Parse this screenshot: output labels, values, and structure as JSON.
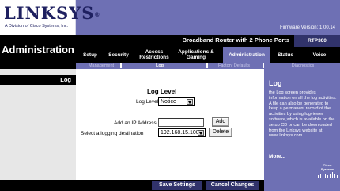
{
  "brand": {
    "logo_text": "LINKSYS",
    "tagline": "A Division of Cisco Systems, Inc.",
    "firmware": "Firmware Version: 1.00.14"
  },
  "header": {
    "section_title": "Administration",
    "product_name": "Broadband Router with 2 Phone Ports",
    "model": "RTP300"
  },
  "tabs": [
    {
      "label": "Setup"
    },
    {
      "label": "Security"
    },
    {
      "label": "Access Restrictions"
    },
    {
      "label": "Applications & Gaming"
    },
    {
      "label": "Administration",
      "active": true
    },
    {
      "label": "Status"
    },
    {
      "label": "Voice"
    }
  ],
  "subtabs": [
    {
      "label": "Management"
    },
    {
      "label": "Log",
      "active": true
    },
    {
      "label": "Factory Defaults"
    },
    {
      "label": "Diagnostics"
    }
  ],
  "left_section_label": "Log",
  "form": {
    "title": "Log Level",
    "log_level_label": "Log Level",
    "log_level_value": "Notice",
    "add_ip_label": "Add an IP Address",
    "add_ip_value": "",
    "add_button": "Add",
    "destination_label": "Select a logging destination",
    "destination_value": "192.168.15.100",
    "delete_button": "Delete"
  },
  "help": {
    "title": "Log",
    "text": "the Log screen provides information on all the log activities. A file can also be generated to keep a permanent record of the activities by using logviewer software,which is available on the setup CD or can be downloaded from the Linksys website at www.linksys.com",
    "more": "More..."
  },
  "cisco_logo_text": "Cisco Systems",
  "footer": {
    "save": "Save Settings",
    "cancel": "Cancel Changes"
  },
  "colors": {
    "header_purple": "#6e70b4",
    "dark_navy": "#31336b"
  }
}
